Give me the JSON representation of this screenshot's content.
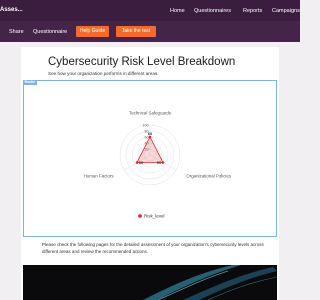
{
  "header": {
    "brand": "Asses...",
    "nav": [
      "Home",
      "Questionnaires",
      "Reports",
      "Campaigns"
    ]
  },
  "subnav": {
    "links": [
      "Share",
      "Questionnaire"
    ],
    "buttons": [
      "Help Guide",
      "Take the test"
    ]
  },
  "page": {
    "title": "Cybersecurity Risk Level Breakdown",
    "subtitle": "See how your organization performs in different areas.",
    "chart_tag": "Radar",
    "note": "Please check the following pages for the detailed assessment of your organization's cybersecurity levels across different areas and review the recommended actions."
  },
  "colors": {
    "header_bg": "#3a1d3f",
    "subnav_bg": "#45244a",
    "accent_button": "#f26b2c",
    "series": "#e0202a",
    "series_fill": "rgba(224,32,42,0.18)"
  },
  "chart_data": {
    "type": "radar",
    "categories": [
      "Technical Safeguards",
      "Organizational Policies",
      "Human Factors"
    ],
    "series": [
      {
        "name": "Risk_level",
        "values": [
          60,
          50,
          50
        ]
      }
    ],
    "data_labels": [
      "60",
      "50",
      "50"
    ],
    "tick_labels": [
      "20",
      "40",
      "60",
      "80",
      "100"
    ],
    "range": [
      0,
      100
    ],
    "legend": "bottom"
  }
}
